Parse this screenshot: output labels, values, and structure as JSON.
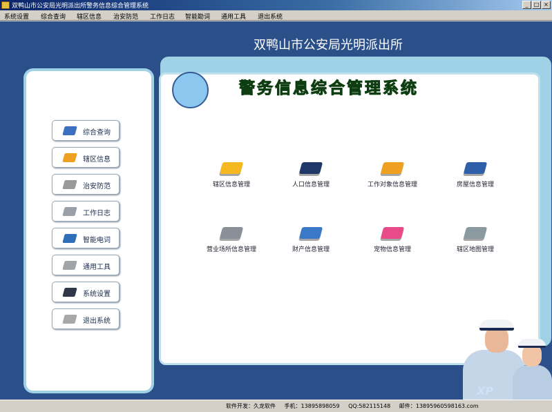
{
  "window": {
    "title": "双鸭山市公安局光明派出所警务信息综合管理系统",
    "min_label": "_",
    "max_label": "□",
    "close_label": "×"
  },
  "menu": [
    "系统设置",
    "综合查询",
    "辖区信息",
    "治安防范",
    "工作日志",
    "智能勘词",
    "通用工具",
    "退出系统"
  ],
  "header": {
    "org_name": "双鸭山市公安局光明派出所",
    "system_title": "警务信息综合管理系统"
  },
  "left_buttons": [
    {
      "label": "综合查询",
      "icon": "search-icon",
      "color": "#3b6fbf"
    },
    {
      "label": "辖区信息",
      "icon": "district-icon",
      "color": "#f0a020"
    },
    {
      "label": "治安防范",
      "icon": "security-icon",
      "color": "#9a9a9a"
    },
    {
      "label": "工作日志",
      "icon": "log-icon",
      "color": "#9aa0a8"
    },
    {
      "label": "智能电词",
      "icon": "smart-icon",
      "color": "#2f6fb8"
    },
    {
      "label": "通用工具",
      "icon": "tools-icon",
      "color": "#a0a4a8"
    },
    {
      "label": "系统设置",
      "icon": "settings-icon",
      "color": "#303848"
    },
    {
      "label": "退出系统",
      "icon": "exit-icon",
      "color": "#a8a8a8"
    }
  ],
  "modules": [
    {
      "label": "辖区信息管理",
      "icon": "district-info-icon",
      "color": "#f5b820"
    },
    {
      "label": "人口信息管理",
      "icon": "population-icon",
      "color": "#203868"
    },
    {
      "label": "工作对象信息管理",
      "icon": "work-object-icon",
      "color": "#f0a020"
    },
    {
      "label": "房屋信息管理",
      "icon": "housing-icon",
      "color": "#2f5fa8"
    },
    {
      "label": "营业场所信息管理",
      "icon": "business-venue-icon",
      "color": "#8a9098"
    },
    {
      "label": "财产信息管理",
      "icon": "property-icon",
      "color": "#3b78c8"
    },
    {
      "label": "宠物信息管理",
      "icon": "pet-icon",
      "color": "#e84a8a"
    },
    {
      "label": "辖区地图管理",
      "icon": "map-icon",
      "color": "#8a9aa0"
    }
  ],
  "status": {
    "developer": "软件开发：久龙软件",
    "phone": "手机：13895898059",
    "qq": "QQ:582115148",
    "email": "邮件：13895960598163.com"
  },
  "watermark": "XP"
}
